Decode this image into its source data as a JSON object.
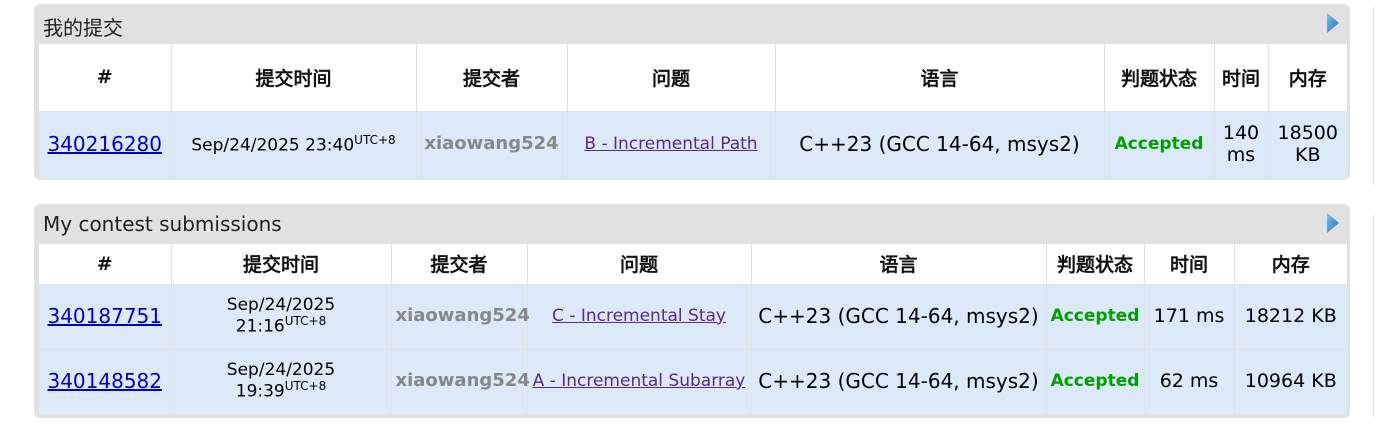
{
  "my_submissions": {
    "title": "我的提交",
    "headers": [
      "#",
      "提交时间",
      "提交者",
      "问题",
      "语言",
      "判题状态",
      "时间",
      "内存"
    ],
    "rows": [
      {
        "id": "340216280",
        "date": "Sep/24/2025 23:40",
        "tz": "UTC+8",
        "author": "xiaowang524",
        "problem": "B - Incremental Path",
        "language": "C++23 (GCC 14-64, msys2)",
        "verdict": "Accepted",
        "time": "140 ms",
        "memory": "18500 KB"
      }
    ]
  },
  "contest_submissions": {
    "title": "My contest submissions",
    "headers": [
      "#",
      "提交时间",
      "提交者",
      "问题",
      "语言",
      "判题状态",
      "时间",
      "内存"
    ],
    "rows": [
      {
        "id": "340187751",
        "date": "Sep/24/2025",
        "clock": "21:16",
        "tz": "UTC+8",
        "author": "xiaowang524",
        "problem": "C - Incremental Stay",
        "language": "C++23 (GCC 14-64, msys2)",
        "verdict": "Accepted",
        "time": "171 ms",
        "memory": "18212 KB"
      },
      {
        "id": "340148582",
        "date": "Sep/24/2025",
        "clock": "19:39",
        "tz": "UTC+8",
        "author": "xiaowang524",
        "problem": "A - Incremental Subarray",
        "language": "C++23 (GCC 14-64, msys2)",
        "verdict": "Accepted",
        "time": "62 ms",
        "memory": "10964 KB"
      }
    ]
  },
  "colors": {
    "panel_bg": "#e1e1e1",
    "row_bg": "#dce9f8",
    "link_blue": "#0000cc",
    "problem_link": "#5b2a86",
    "accepted_green": "#00a000",
    "arrow_blue": "#2f8fd8"
  },
  "icons": {
    "panel_toggle": "triangle-right-icon"
  }
}
